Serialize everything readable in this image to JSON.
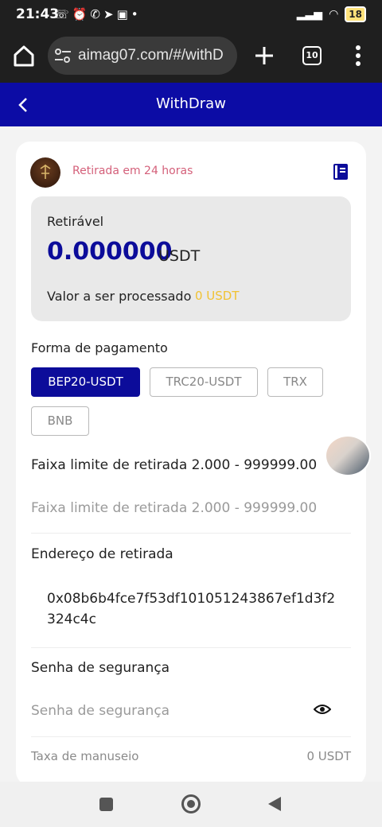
{
  "status_bar": {
    "time": "21:43",
    "battery": "18"
  },
  "browser": {
    "url": "aimag07.com/#/withD",
    "tab_count": "10"
  },
  "header": {
    "title": "WithDraw"
  },
  "notice": "Retirada em 24 horas",
  "balance": {
    "label": "Retirável",
    "amount": "0.000000",
    "unit": "USDT",
    "processing_label": "Valor a ser processado",
    "processing_value": "0 USDT"
  },
  "payment": {
    "label": "Forma de pagamento",
    "options": [
      "BEP20-USDT",
      "TRC20-USDT",
      "TRX",
      "BNB"
    ],
    "selected": "BEP20-USDT"
  },
  "limit": {
    "label": "Faixa limite de retirada 2.000 - 999999.00",
    "placeholder": "Faixa limite de retirada 2.000 - 999999.00"
  },
  "address": {
    "label": "Endereço de retirada",
    "value": "0x08b6b4fce7f53df101051243867ef1d3f2324c4c"
  },
  "password": {
    "label": "Senha de segurança",
    "placeholder": "Senha de segurança"
  },
  "fee": {
    "label": "Taxa de manuseio",
    "value": "0 USDT"
  },
  "colors": {
    "brand": "#0c0ca5",
    "notice": "#d4607a",
    "processing": "#f1c232"
  }
}
